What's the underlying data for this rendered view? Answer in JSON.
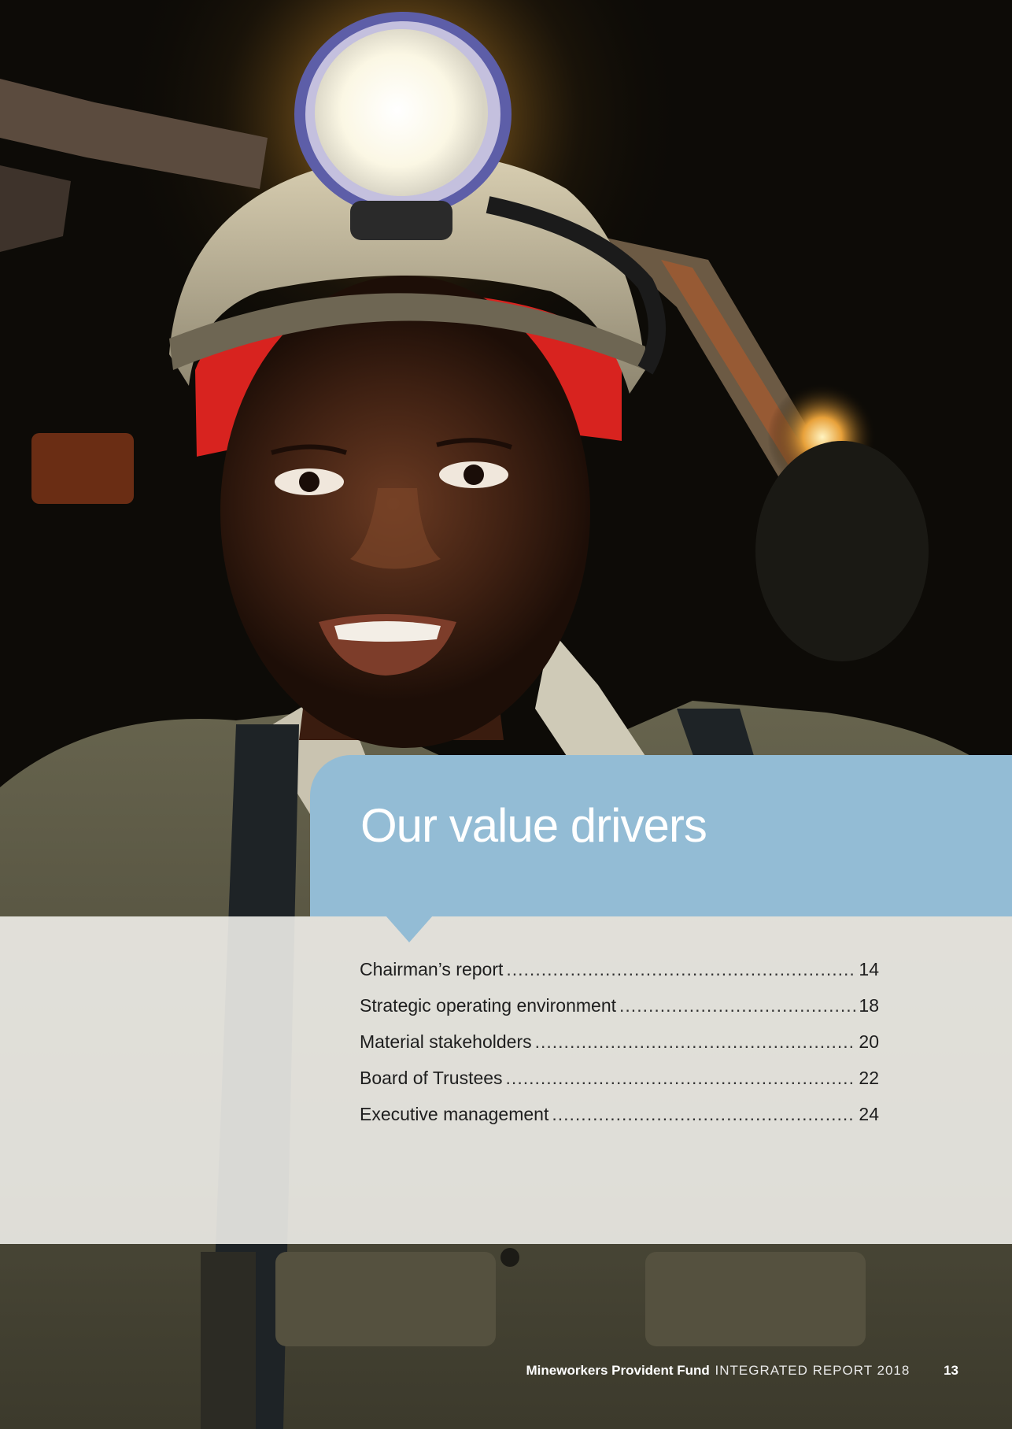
{
  "section": {
    "title": "Our value drivers"
  },
  "contents": [
    {
      "label": "Chairman’s report",
      "page": "14"
    },
    {
      "label": "Strategic operating environment",
      "page": "18"
    },
    {
      "label": "Material stakeholders",
      "page": "20"
    },
    {
      "label": "Board of Trustees",
      "page": "22"
    },
    {
      "label": "Executive management",
      "page": "24"
    }
  ],
  "footer": {
    "brand": "Mineworkers Provident Fund",
    "report": "INTEGRATED REPORT 2018",
    "page_number": "13"
  },
  "colors": {
    "title_box": "#93bcd5",
    "band": "#f4f3ee",
    "helmet_strap": "#d8231f"
  },
  "image": {
    "subject": "photo of a smiling miner wearing a helmet with a headlamp and a red headband"
  }
}
